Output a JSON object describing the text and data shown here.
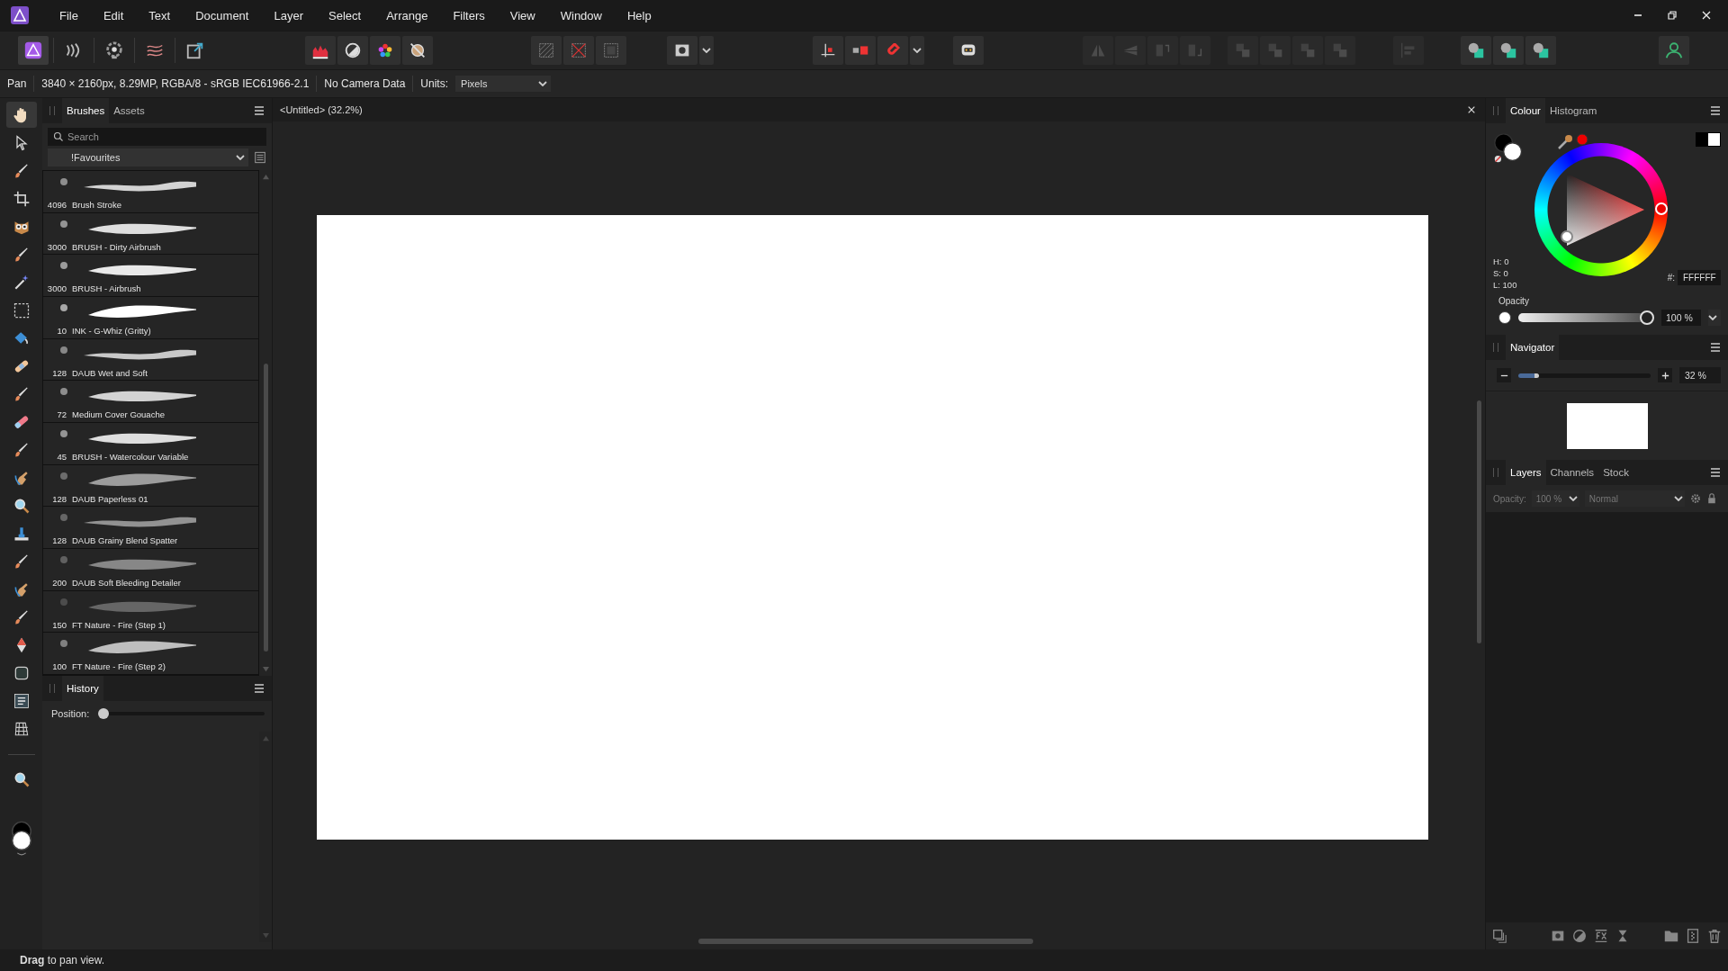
{
  "menu": [
    "File",
    "Edit",
    "Text",
    "Document",
    "Layer",
    "Select",
    "Arrange",
    "Filters",
    "View",
    "Window",
    "Help"
  ],
  "personas": [
    {
      "kind": "photo",
      "selected": true
    },
    {
      "kind": "liquify",
      "selected": false
    },
    {
      "kind": "develop",
      "selected": false
    },
    {
      "kind": "tonemap",
      "selected": false
    },
    {
      "kind": "export",
      "selected": false
    }
  ],
  "toolbar_groups": [
    [
      {
        "kind": "levels",
        "disabled": false
      },
      {
        "kind": "contrast",
        "disabled": false
      },
      {
        "kind": "hsl",
        "disabled": false
      },
      {
        "kind": "balance",
        "disabled": false
      }
    ],
    [
      {
        "kind": "hatch",
        "disabled": false
      },
      {
        "kind": "deselect",
        "disabled": false
      },
      {
        "kind": "invert",
        "disabled": false
      }
    ],
    [
      {
        "kind": "mask",
        "disabled": false
      },
      {
        "kind": "caret",
        "disabled": false
      }
    ],
    [
      {
        "kind": "grid",
        "disabled": false
      },
      {
        "kind": "bars",
        "disabled": false
      },
      {
        "kind": "magnet",
        "disabled": false
      },
      {
        "kind": "caret",
        "disabled": false
      }
    ],
    [
      {
        "kind": "robot",
        "disabled": false
      }
    ],
    [
      {
        "kind": "fliph",
        "disabled": true
      },
      {
        "kind": "flipv",
        "disabled": true
      },
      {
        "kind": "rotl",
        "disabled": true
      },
      {
        "kind": "rotr",
        "disabled": true
      }
    ],
    [
      {
        "kind": "arrange",
        "disabled": true
      },
      {
        "kind": "arrange",
        "disabled": true
      },
      {
        "kind": "arrange",
        "disabled": true
      },
      {
        "kind": "arrange",
        "disabled": true
      }
    ],
    [
      {
        "kind": "align",
        "disabled": true
      }
    ],
    [
      {
        "kind": "union",
        "disabled": false
      },
      {
        "kind": "union",
        "disabled": false
      },
      {
        "kind": "union",
        "disabled": false
      }
    ],
    [
      {
        "kind": "user",
        "disabled": false
      }
    ]
  ],
  "context_bar": {
    "tool": "Pan",
    "document_info": "3840 × 2160px, 8.29MP, RGBA/8 - sRGB IEC61966-2.1",
    "camera": "No Camera Data",
    "units_label": "Units:",
    "units": "Pixels"
  },
  "tools": [
    {
      "kind": "hand",
      "selected": true
    },
    {
      "kind": "pointer",
      "selected": false
    },
    {
      "kind": "brush",
      "selected": false
    },
    {
      "kind": "crop",
      "selected": false
    },
    {
      "kind": "owl",
      "selected": false
    },
    {
      "kind": "brush",
      "selected": false
    },
    {
      "kind": "wand",
      "selected": false
    },
    {
      "kind": "marquee",
      "selected": false
    },
    {
      "kind": "bucket",
      "selected": false
    },
    {
      "kind": "bandage",
      "selected": false
    },
    {
      "kind": "brush",
      "selected": false
    },
    {
      "kind": "eraser",
      "selected": false
    },
    {
      "kind": "brush",
      "selected": false
    },
    {
      "kind": "finger",
      "selected": false
    },
    {
      "kind": "magnifier",
      "selected": false
    },
    {
      "kind": "stamp",
      "selected": false
    },
    {
      "kind": "brush",
      "selected": false
    },
    {
      "kind": "finger",
      "selected": false
    },
    {
      "kind": "brush",
      "selected": false
    },
    {
      "kind": "pen",
      "selected": false
    },
    {
      "kind": "square",
      "selected": false
    },
    {
      "kind": "textframe",
      "selected": false
    },
    {
      "kind": "mesh",
      "selected": false
    },
    {
      "kind": "magnifier",
      "selected": false
    }
  ],
  "brushes_panel": {
    "tabs": [
      {
        "label": "Brushes",
        "selected": true
      },
      {
        "label": "Assets",
        "selected": false
      }
    ],
    "search": {
      "placeholder": "Search"
    },
    "category": "!Favourites",
    "brushes": [
      {
        "size": "4096",
        "name": "Brush Stroke"
      },
      {
        "size": "3000",
        "name": "BRUSH - Dirty Airbrush"
      },
      {
        "size": "3000",
        "name": "BRUSH - Airbrush"
      },
      {
        "size": "10",
        "name": "INK - G-Whiz (Gritty)"
      },
      {
        "size": "128",
        "name": "DAUB Wet and Soft"
      },
      {
        "size": "72",
        "name": "Medium Cover Gouache"
      },
      {
        "size": "45",
        "name": "BRUSH - Watercolour Variable"
      },
      {
        "size": "128",
        "name": "DAUB Paperless 01"
      },
      {
        "size": "128",
        "name": "DAUB Grainy Blend Spatter"
      },
      {
        "size": "200",
        "name": "DAUB Soft Bleeding Detailer"
      },
      {
        "size": "150",
        "name": "FT Nature - Fire (Step 1)"
      },
      {
        "size": "100",
        "name": "FT Nature - Fire (Step 2)"
      }
    ]
  },
  "history_panel": {
    "tab": "History",
    "position_label": "Position:",
    "level": 0
  },
  "document_tab": {
    "title": "<Untitled> (32.2%)"
  },
  "colour_panel": {
    "tabs": [
      {
        "label": "Colour",
        "selected": true
      },
      {
        "label": "Histogram",
        "selected": false
      }
    ],
    "h": "H: 0",
    "s": "S: 0",
    "l": "L: 100",
    "hex_label": "#:",
    "hex": "FFFFFF",
    "opacity_label": "Opacity",
    "opacity": "100 %",
    "level": 1
  },
  "navigator_panel": {
    "tab": "Navigator",
    "zoom": "32 %",
    "level": 0.12
  },
  "layers_panel": {
    "tabs": [
      {
        "label": "Layers",
        "selected": true
      },
      {
        "label": "Channels",
        "selected": false
      },
      {
        "label": "Stock",
        "selected": false
      }
    ],
    "opacity_label": "Opacity:",
    "opacity": "100 %",
    "blend_mode": "Normal",
    "disabled": true
  },
  "status_bar": "**Drag** to pan view."
}
